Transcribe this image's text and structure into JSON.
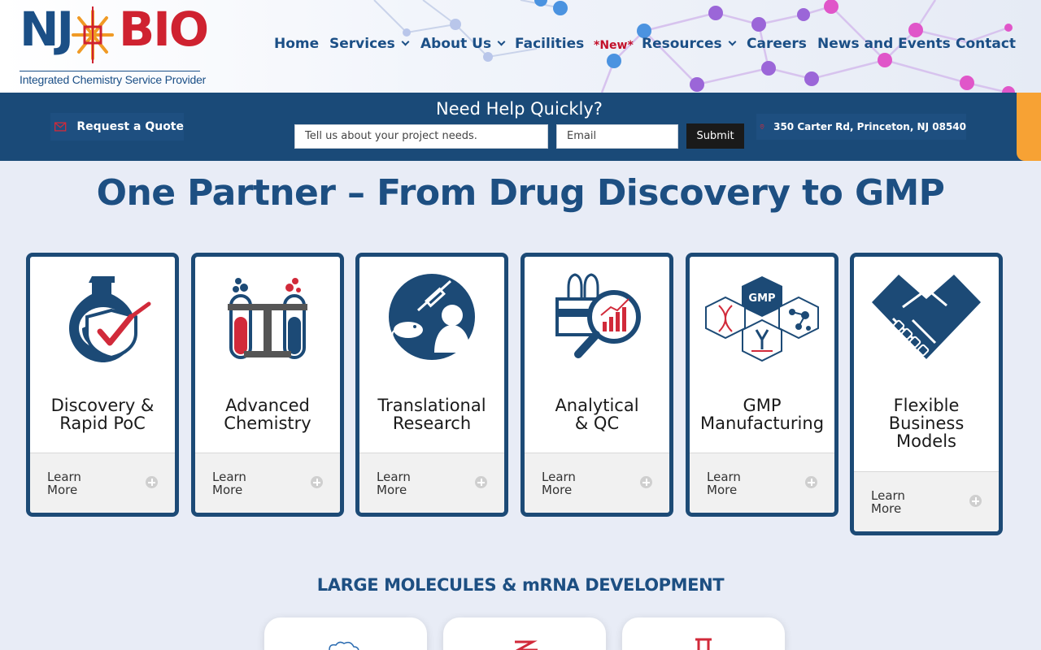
{
  "brand": {
    "logo_left": "NJ",
    "logo_right": "BIO",
    "tagline": "Integrated Chemistry Service Provider",
    "colors": {
      "navy": "#1b4f86",
      "red": "#cf2230",
      "orange": "#f7a234",
      "band": "#1a4a78"
    }
  },
  "nav": {
    "home": "Home",
    "services": "Services",
    "about": "About Us",
    "facilities": "Facilities",
    "new_badge": "*New*",
    "resources": "Resources",
    "careers": "Careers",
    "news": "News and Events",
    "contact": "Contact"
  },
  "help": {
    "quote_label": "Request a Quote",
    "title": "Need Help Quickly?",
    "project_placeholder": "Tell us about your project needs.",
    "email_placeholder": "Email",
    "submit_label": "Submit",
    "address": "350 Carter Rd, Princeton, NJ 08540"
  },
  "headline": "One Partner – From Drug Discovery to GMP",
  "cards": [
    {
      "title_line1": "Discovery &",
      "title_line2": "Rapid PoC",
      "icon": "flask-shield-check-icon",
      "learn1": "Learn",
      "learn2": "More"
    },
    {
      "title_line1": "Advanced",
      "title_line2": "Chemistry",
      "icon": "test-tubes-icon",
      "learn1": "Learn",
      "learn2": "More"
    },
    {
      "title_line1": "Translational",
      "title_line2": "Research",
      "icon": "researcher-syringe-icon",
      "learn1": "Learn",
      "learn2": "More"
    },
    {
      "title_line1": "Analytical",
      "title_line2": "& QC",
      "icon": "magnifier-chart-icon",
      "learn1": "Learn",
      "learn2": "More"
    },
    {
      "title_line1": "GMP",
      "title_line2": "Manufacturing",
      "icon": "gmp-hexagons-icon",
      "learn1": "Learn",
      "learn2": "More"
    },
    {
      "title_line1": "Flexible",
      "title_line2": "Business",
      "title_line3": "Models",
      "icon": "handshake-icon",
      "learn1": "Learn",
      "learn2": "More"
    }
  ],
  "section2": {
    "title": "LARGE MOLECULES & mRNA DEVELOPMENT"
  }
}
